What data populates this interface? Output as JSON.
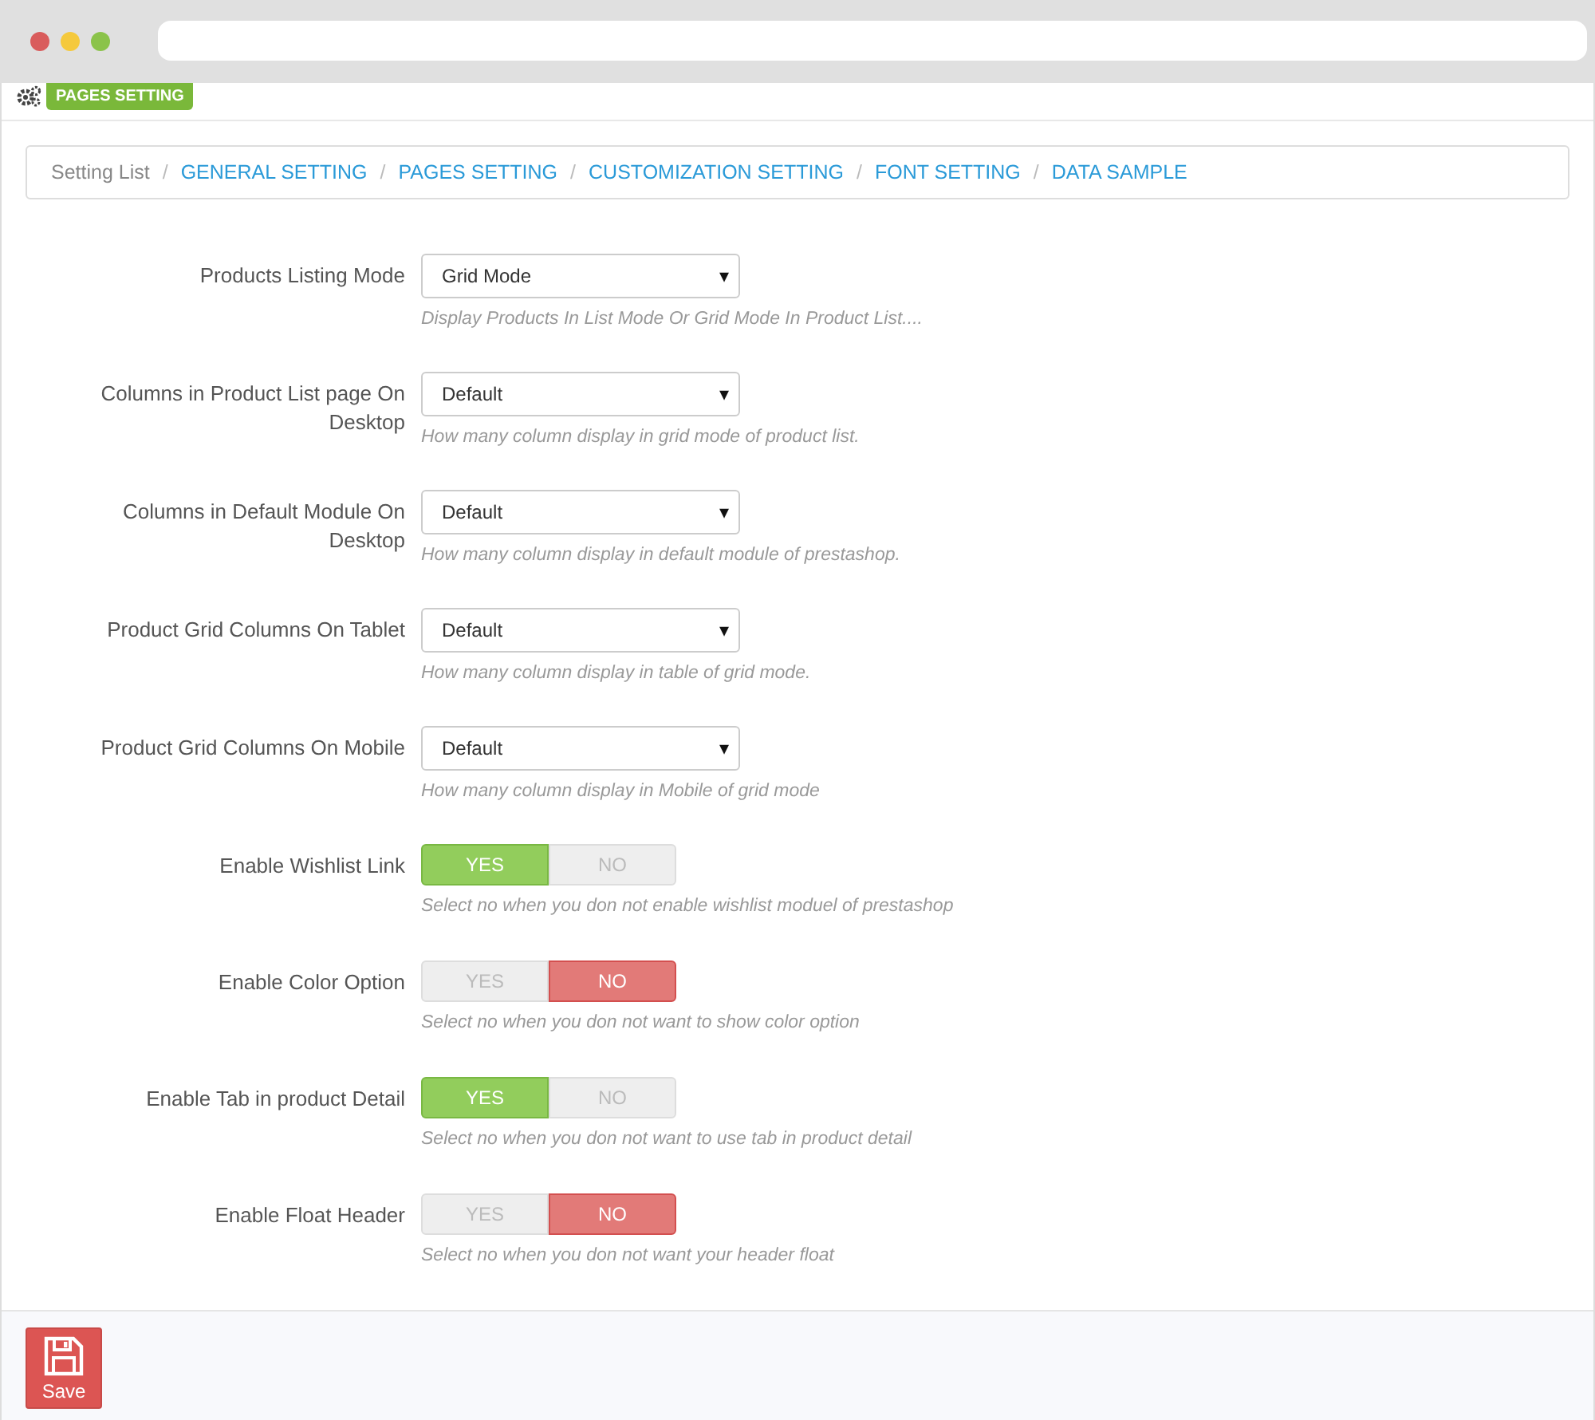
{
  "header": {
    "badge": "PAGES SETTING"
  },
  "breadcrumb": [
    {
      "kind": "text",
      "label": "Setting List"
    },
    {
      "kind": "link",
      "label": "GENERAL SETTING"
    },
    {
      "kind": "link",
      "label": "PAGES SETTING"
    },
    {
      "kind": "link",
      "label": "CUSTOMIZATION SETTING"
    },
    {
      "kind": "link",
      "label": "FONT SETTING"
    },
    {
      "kind": "link",
      "label": "DATA SAMPLE"
    }
  ],
  "breadcrumb_separator": "/",
  "fields": [
    {
      "kind": "select",
      "label": "Products Listing Mode",
      "value": "Grid Mode",
      "caret": "▾",
      "help": "Display Products In List Mode Or Grid Mode In Product List...."
    },
    {
      "kind": "select",
      "label": "Columns in Product List page On Desktop",
      "value": "Default",
      "caret": "▾",
      "help": "How many column display in grid mode of product list."
    },
    {
      "kind": "select",
      "label": "Columns in Default Module On Desktop",
      "value": "Default",
      "caret": "▾",
      "help": "How many column display in default module of prestashop."
    },
    {
      "kind": "select",
      "label": "Product Grid Columns On Tablet",
      "value": "Default",
      "caret": "▾",
      "help": "How many column display in table of grid mode."
    },
    {
      "kind": "select",
      "label": "Product Grid Columns On Mobile",
      "value": "Default",
      "caret": "▾",
      "help": "How many column display in Mobile of grid mode"
    },
    {
      "kind": "toggle",
      "label": "Enable Wishlist Link",
      "on": true,
      "yes": "YES",
      "no": "NO",
      "help": "Select no when you don not enable wishlist moduel of prestashop"
    },
    {
      "kind": "toggle",
      "label": "Enable Color Option",
      "on": false,
      "yes": "YES",
      "no": "NO",
      "help": "Select no when you don not want to show color option"
    },
    {
      "kind": "toggle",
      "label": "Enable Tab in product Detail",
      "on": true,
      "yes": "YES",
      "no": "NO",
      "help": "Select no when you don not want to use tab in product detail"
    },
    {
      "kind": "toggle",
      "label": "Enable Float Header",
      "on": false,
      "yes": "YES",
      "no": "NO",
      "help": "Select no when you don not want your header float"
    }
  ],
  "footer": {
    "save_label": "Save"
  }
}
